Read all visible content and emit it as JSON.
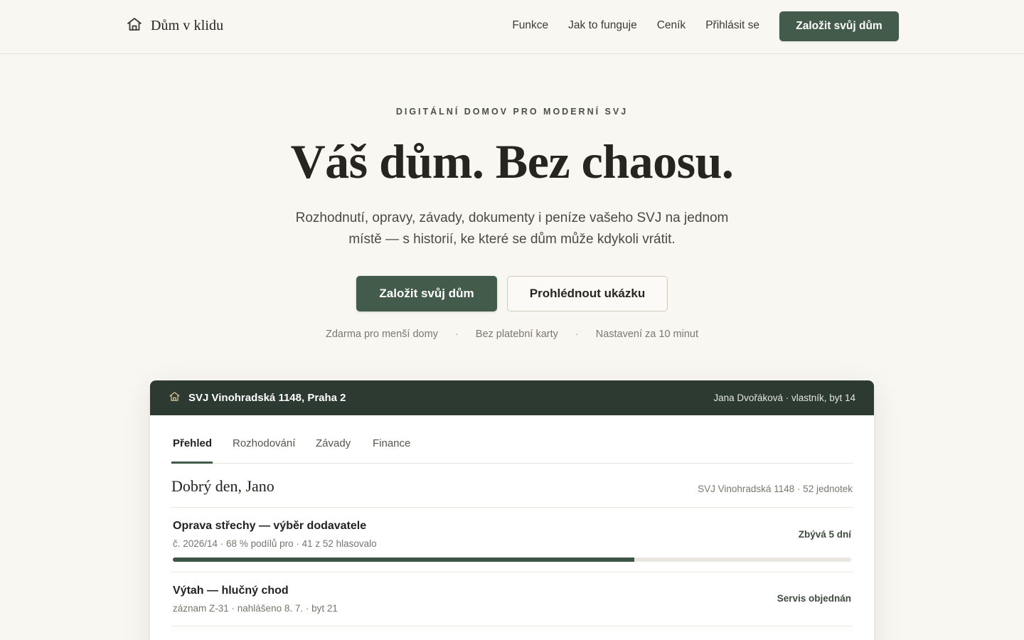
{
  "brand": {
    "name": "Dům v klidu",
    "icon": "house-icon"
  },
  "nav": {
    "links": [
      "Funkce",
      "Jak to funguje",
      "Ceník",
      "Přihlásit se"
    ],
    "cta": "Založit svůj dům"
  },
  "hero": {
    "eyebrow": "DIGITÁLNÍ DOMOV PRO MODERNÍ SVJ",
    "headline": "Váš dům. Bez chaosu.",
    "subhead": "Rozhodnutí, opravy, závady, dokumenty i peníze vašeho SVJ na jednom místě — s historií, ke které se dům může kdykoli vrátit.",
    "primary_cta": "Založit svůj dům",
    "secondary_cta": "Prohlédnout ukázku",
    "perks": [
      "Zdarma pro menší domy",
      "Bez platební karty",
      "Nastavení za 10 minut"
    ],
    "perk_separator": "·"
  },
  "preview": {
    "building": "SVJ Vinohradská 1148, Praha 2",
    "user": "Jana Dvořáková · vlastník, byt 14",
    "tabs": [
      "Přehled",
      "Rozhodování",
      "Závady",
      "Finance"
    ],
    "active_tab": "Přehled",
    "greeting": "Dobrý den, Jano",
    "greeting_meta": "SVJ Vinohradská 1148 · 52 jednotek",
    "items": [
      {
        "title": "Oprava střechy — výběr dodavatele",
        "meta": "č. 2026/14 · 68 % podílů pro · 41 z 52 hlasovalo",
        "status": "Zbývá 5 dní",
        "progress": 0.68
      },
      {
        "title": "Výtah — hlučný chod",
        "meta": "záznam Z-31 · nahlášeno 8. 7. · byt 21",
        "status": "Servis objednán"
      }
    ]
  },
  "colors": {
    "background": "#f9f7f1",
    "accent": "#435b4a",
    "preview_bar": "#2c3a31"
  }
}
